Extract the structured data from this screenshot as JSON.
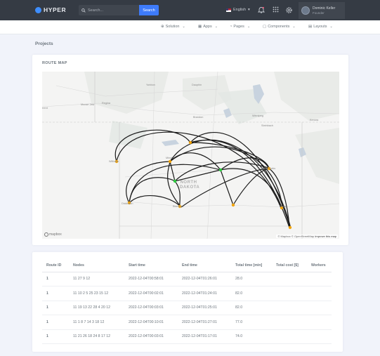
{
  "brand": {
    "name": "HYPER",
    "accent": "#3e7bfa"
  },
  "search": {
    "placeholder": "Search...",
    "button": "Search"
  },
  "language": "English",
  "user": {
    "name": "Dominic Keller",
    "role": "Founder"
  },
  "menu": [
    {
      "label": "Solution",
      "icon": "layers-icon"
    },
    {
      "label": "Apps",
      "icon": "apps-icon"
    },
    {
      "label": "Pages",
      "icon": "pages-icon"
    },
    {
      "label": "Components",
      "icon": "components-icon"
    },
    {
      "label": "Layouts",
      "icon": "layouts-icon"
    }
  ],
  "page": {
    "title": "Projects"
  },
  "map_card": {
    "title": "ROUTE MAP",
    "labels": {
      "yorkton": "Yorkton",
      "dauphin": "Dauphin",
      "regina": "Regina",
      "moose_jaw": "Moose Jaw",
      "swift": "rrent",
      "brandon": "Brandon",
      "winnipeg": "Winnipeg",
      "steinbach": "Steinbach",
      "kenora": "Kenora",
      "williston": "Williston",
      "minot": "Minot",
      "grand_forks": "Grand Forks",
      "dickinson": "Dickinson",
      "bismarck": "Bismarck",
      "fargo": "Fargo",
      "north_dakota": "NORTH DAKOTA"
    },
    "attribution": "© Mapbox © OpenStreetMap",
    "improve": "Improve this map",
    "logo": "mapbox",
    "route_color": "#1a1a1a",
    "node_color": "#f0a30a",
    "active_node_color": "#2ecc40"
  },
  "routes_table": {
    "headers": [
      "Route ID",
      "Nodes",
      "Start time",
      "End time",
      "Total time [min]",
      "Total cost [$]",
      "Workers"
    ],
    "rows": [
      {
        "id": "1",
        "nodes": "11 27 9 12",
        "start": "2022-12-04T00:58:01",
        "end": "2022-12-04T01:26:01",
        "time": "28.0",
        "cost": "",
        "workers": ""
      },
      {
        "id": "1",
        "nodes": "11 10 2 5 25 23 15 12",
        "start": "2022-12-04T00:02:01",
        "end": "2022-12-04T01:24:01",
        "time": "82.0",
        "cost": "",
        "workers": ""
      },
      {
        "id": "1",
        "nodes": "11 19 13 22 28 4 20 12",
        "start": "2022-12-04T00:03:01",
        "end": "2022-12-04T01:25:01",
        "time": "82.0",
        "cost": "",
        "workers": ""
      },
      {
        "id": "1",
        "nodes": "11 1 8 7 14 3 18 12",
        "start": "2022-12-04T00:10:01",
        "end": "2022-12-04T01:27:01",
        "time": "77.0",
        "cost": "",
        "workers": ""
      },
      {
        "id": "1",
        "nodes": "11 21 26 18 24 8 17 12",
        "start": "2022-12-04T00:03:01",
        "end": "2022-12-04T01:17:01",
        "time": "74.0",
        "cost": "",
        "workers": ""
      }
    ]
  }
}
